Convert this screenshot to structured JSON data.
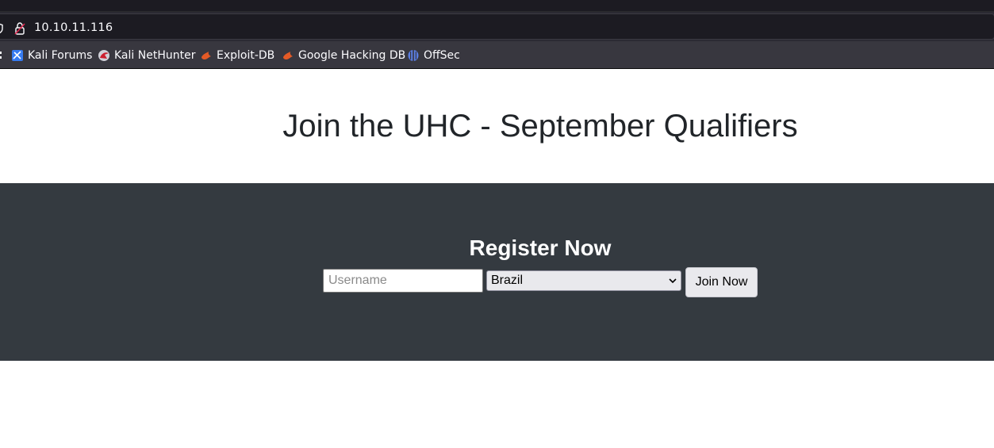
{
  "browser": {
    "url": "10.10.11.116",
    "bookmarks": [
      {
        "label": "Kali Forums",
        "icon": "kali-forums-icon"
      },
      {
        "label": "Kali NetHunter",
        "icon": "kali-nethunter-icon"
      },
      {
        "label": "Exploit-DB",
        "icon": "exploit-db-icon"
      },
      {
        "label": "Google Hacking DB",
        "icon": "google-hacking-db-icon"
      },
      {
        "label": "OffSec",
        "icon": "offsec-icon"
      }
    ]
  },
  "page": {
    "title": "Join the UHC - September Qualifiers",
    "register": {
      "heading": "Register Now",
      "username_placeholder": "Username",
      "country_selected": "Brazil",
      "join_label": "Join Now"
    }
  },
  "colors": {
    "browser_chrome": "#2b2a33",
    "bookmarks_bar": "#38373f",
    "register_bg": "#343a40",
    "heading_text": "#212529"
  }
}
